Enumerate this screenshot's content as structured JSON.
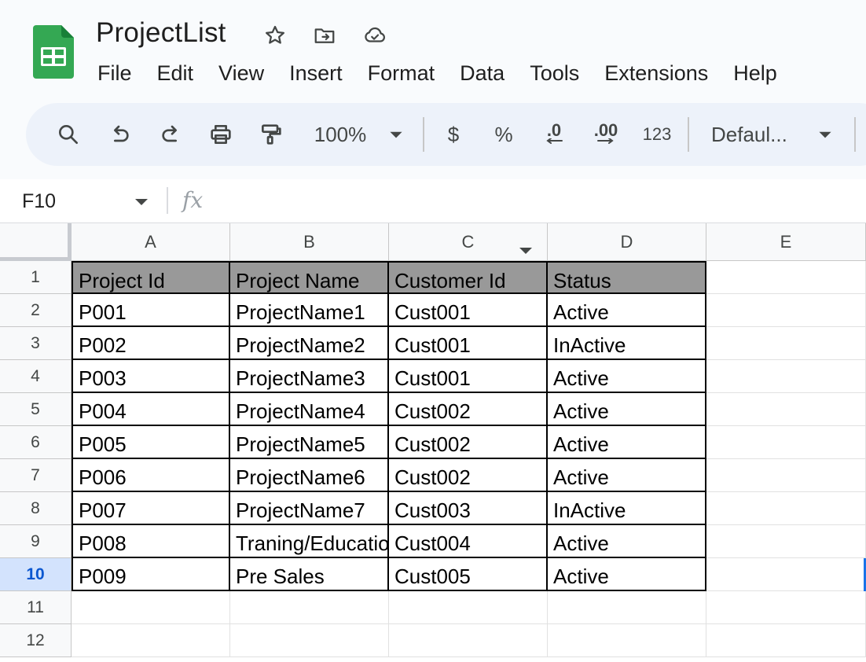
{
  "app": {
    "title": "ProjectList",
    "icons": {
      "logo": "google-sheets-logo",
      "star": "star-icon",
      "move": "move-to-folder-icon",
      "cloud": "cloud-saved-icon"
    }
  },
  "menu": [
    "File",
    "Edit",
    "View",
    "Insert",
    "Format",
    "Data",
    "Tools",
    "Extensions",
    "Help"
  ],
  "toolbar": {
    "zoom": "100%",
    "currency": "$",
    "percent": "%",
    "decrease_decimal": ".0",
    "increase_decimal": ".00",
    "number_format": "123",
    "font": "Defaul..."
  },
  "formula_bar": {
    "name_box": "F10",
    "fx": "fx",
    "value": ""
  },
  "grid": {
    "columns": [
      "A",
      "B",
      "C",
      "D",
      "E"
    ],
    "rows": [
      "1",
      "2",
      "3",
      "4",
      "5",
      "6",
      "7",
      "8",
      "9",
      "10",
      "11",
      "12"
    ],
    "active_row": "10",
    "header_fill": "#999999",
    "cells": [
      [
        "Project Id",
        "Project Name",
        "Customer Id",
        "Status"
      ],
      [
        "P001",
        "ProjectName1",
        "Cust001",
        "Active"
      ],
      [
        "P002",
        "ProjectName2",
        "Cust001",
        "InActive"
      ],
      [
        "P003",
        "ProjectName3",
        "Cust001",
        "Active"
      ],
      [
        "P004",
        "ProjectName4",
        "Cust002",
        "Active"
      ],
      [
        "P005",
        "ProjectName5",
        "Cust002",
        "Active"
      ],
      [
        "P006",
        "ProjectName6",
        "Cust002",
        "Active"
      ],
      [
        "P007",
        "ProjectName7",
        "Cust003",
        "InActive"
      ],
      [
        "P008",
        "Traning/Education",
        "Cust004",
        "Active"
      ],
      [
        "P009",
        "Pre Sales",
        "Cust005",
        "Active"
      ]
    ]
  }
}
